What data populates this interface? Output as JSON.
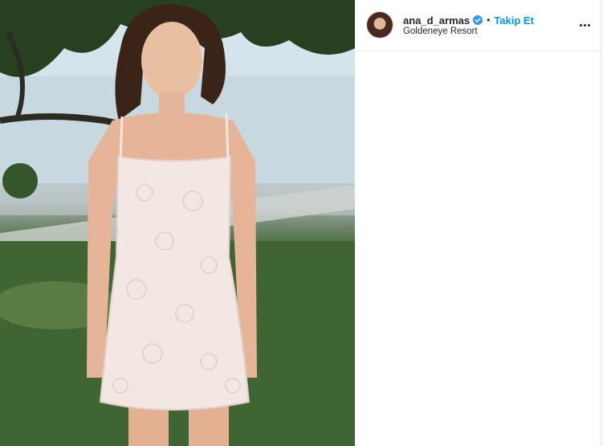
{
  "post": {
    "photo": {
      "subject": "portrait-photo"
    },
    "header": {
      "username": "ana_d_armas",
      "verified_icon": "verified-badge-icon",
      "separator": "•",
      "follow_label": "Takip Et",
      "location": "Goldeneye Resort",
      "more_icon": "more-options-icon"
    }
  },
  "colors": {
    "follow_blue": "#0095f6",
    "text": "#262626",
    "divider": "#efefef"
  }
}
